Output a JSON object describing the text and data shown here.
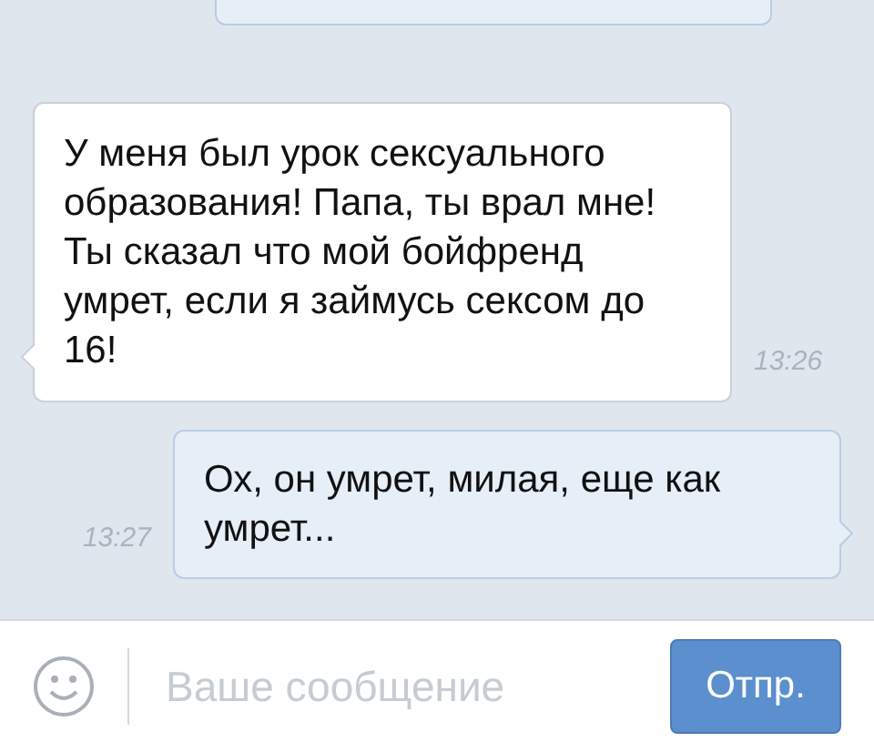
{
  "messages": [
    {
      "kind": "partial"
    },
    {
      "kind": "incoming",
      "text": "У меня был урок сексуального образования! Папа, ты врал мне! Ты сказал что мой бойфренд умрет, если я займусь сексом до 16!",
      "time": "13:26"
    },
    {
      "kind": "outgoing",
      "text": "Ох, он умрет, милая, еще как умрет...",
      "time": "13:27"
    }
  ],
  "composer": {
    "placeholder": "Ваше сообщение",
    "send": "Отпр."
  }
}
